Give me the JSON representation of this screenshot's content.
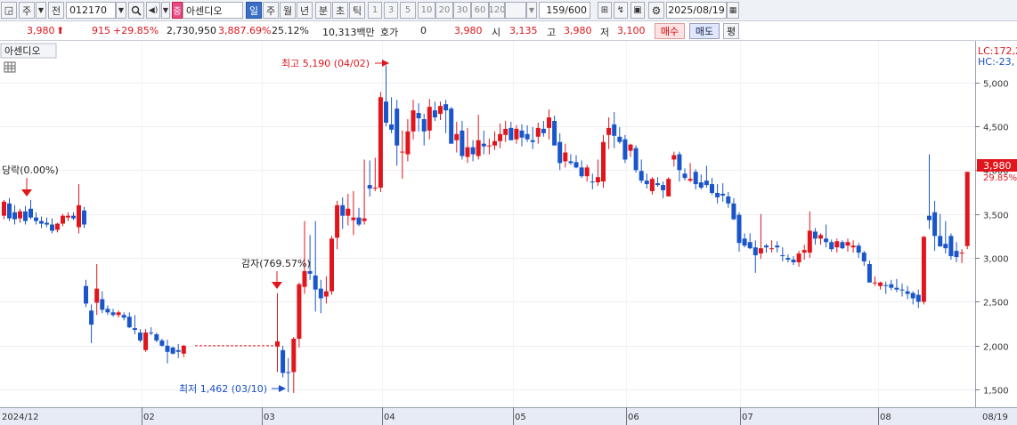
{
  "toolbar": {
    "period_type": "주",
    "prev_label": "전",
    "stock_code": "012170",
    "stock_badge": "중",
    "stock_name": "아센디오",
    "periods": [
      "일",
      "주",
      "월",
      "년",
      "분",
      "초",
      "틱"
    ],
    "selected_period": "일",
    "intervals": [
      "1",
      "3",
      "5",
      "10",
      "20",
      "30",
      "60",
      "120"
    ],
    "page_count": "159/600",
    "date": "2025/08/19"
  },
  "infobar": {
    "price": "3,980",
    "change": "915",
    "change_pct": "+29.85%",
    "volume": "2,730,950",
    "volume_pct": "3,887.69%",
    "turnover": "25.12%",
    "amount": "10,313백만",
    "quote_label": "호가",
    "quote_value": "0",
    "quote_price": "3,980",
    "open_label": "시",
    "open": "3,135",
    "high_label": "고",
    "high": "3,980",
    "low_label": "저",
    "low": "3,100",
    "buy_label": "매수",
    "sell_label": "매도",
    "avg_label": "평"
  },
  "chart_panel": {
    "title": "아센디오",
    "lc_label": "LC:172,2",
    "hc_label": "HC:-23,",
    "current_price": "3,980",
    "current_pct": "29.85%"
  },
  "chart_data": {
    "type": "candlestick",
    "yaxis_ticks": [
      1500,
      2000,
      2500,
      3000,
      3500,
      4000,
      4500,
      5000
    ],
    "ylim": [
      1300,
      5400
    ],
    "xaxis_labels": [
      "2024/12",
      "02",
      "03",
      "04",
      "05",
      "06",
      "07",
      "08",
      "08/19"
    ],
    "annotations": [
      {
        "text": "당락(0.00%)"
      },
      {
        "text": "감자(769.57%)"
      },
      {
        "text": "최고 5,190 (04/02)"
      },
      {
        "text": "최저 1,462 (03/10)"
      }
    ],
    "candles": [
      {
        "o": 3480,
        "h": 3660,
        "l": 3440,
        "c": 3640
      },
      {
        "o": 3620,
        "h": 3680,
        "l": 3420,
        "c": 3450
      },
      {
        "o": 3520,
        "h": 3600,
        "l": 3380,
        "c": 3440
      },
      {
        "o": 3450,
        "h": 3560,
        "l": 3400,
        "c": 3530
      },
      {
        "o": 3530,
        "h": 3590,
        "l": 3380,
        "c": 3420
      },
      {
        "o": 3560,
        "h": 3660,
        "l": 3440,
        "c": 3460
      },
      {
        "o": 3460,
        "h": 3520,
        "l": 3380,
        "c": 3420
      },
      {
        "o": 3420,
        "h": 3470,
        "l": 3340,
        "c": 3390
      },
      {
        "o": 3400,
        "h": 3460,
        "l": 3350,
        "c": 3380
      },
      {
        "o": 3380,
        "h": 3450,
        "l": 3280,
        "c": 3310
      },
      {
        "o": 3320,
        "h": 3400,
        "l": 3290,
        "c": 3390
      },
      {
        "o": 3390,
        "h": 3500,
        "l": 3360,
        "c": 3480
      },
      {
        "o": 3460,
        "h": 3520,
        "l": 3420,
        "c": 3480
      },
      {
        "o": 3480,
        "h": 3520,
        "l": 3430,
        "c": 3450
      },
      {
        "o": 3350,
        "h": 3840,
        "l": 3280,
        "c": 3600
      },
      {
        "o": 3540,
        "h": 3580,
        "l": 3340,
        "c": 3380
      },
      {
        "o": 2680,
        "h": 2750,
        "l": 2440,
        "c": 2480
      },
      {
        "o": 2400,
        "h": 2470,
        "l": 2030,
        "c": 2240
      },
      {
        "o": 2490,
        "h": 2930,
        "l": 2350,
        "c": 2650
      },
      {
        "o": 2530,
        "h": 2620,
        "l": 2370,
        "c": 2410
      },
      {
        "o": 2420,
        "h": 2460,
        "l": 2350,
        "c": 2380
      },
      {
        "o": 2380,
        "h": 2420,
        "l": 2330,
        "c": 2350
      },
      {
        "o": 2350,
        "h": 2400,
        "l": 2320,
        "c": 2380
      },
      {
        "o": 2350,
        "h": 2380,
        "l": 2290,
        "c": 2320
      },
      {
        "o": 2330,
        "h": 2380,
        "l": 2200,
        "c": 2210
      },
      {
        "o": 2200,
        "h": 2350,
        "l": 2130,
        "c": 2180
      },
      {
        "o": 2150,
        "h": 2190,
        "l": 2040,
        "c": 2060
      },
      {
        "o": 1950,
        "h": 2190,
        "l": 1930,
        "c": 2150
      },
      {
        "o": 2150,
        "h": 2210,
        "l": 2120,
        "c": 2140
      },
      {
        "o": 2130,
        "h": 2150,
        "l": 2040,
        "c": 2060
      },
      {
        "o": 2060,
        "h": 2080,
        "l": 1990,
        "c": 2000
      },
      {
        "o": 2000,
        "h": 2070,
        "l": 1800,
        "c": 1930
      },
      {
        "o": 1980,
        "h": 1990,
        "l": 1900,
        "c": 1910
      },
      {
        "o": 1950,
        "h": 2020,
        "l": 1860,
        "c": 1930
      },
      {
        "o": 1910,
        "h": 2010,
        "l": 1870,
        "c": 2000
      },
      {
        "o": 1990,
        "h": 2600,
        "l": 1700,
        "c": 2050
      },
      {
        "o": 1950,
        "h": 2000,
        "l": 1640,
        "c": 1690
      },
      {
        "o": 1700,
        "h": 1860,
        "l": 1470,
        "c": 1690
      },
      {
        "o": 1700,
        "h": 2100,
        "l": 1462,
        "c": 2080
      },
      {
        "o": 2080,
        "h": 2720,
        "l": 1980,
        "c": 2700
      },
      {
        "o": 2670,
        "h": 3420,
        "l": 2590,
        "c": 2850
      },
      {
        "o": 2850,
        "h": 3260,
        "l": 2750,
        "c": 2820
      },
      {
        "o": 2800,
        "h": 3420,
        "l": 2390,
        "c": 2640
      },
      {
        "o": 2650,
        "h": 2750,
        "l": 2370,
        "c": 2540
      },
      {
        "o": 2560,
        "h": 2790,
        "l": 2480,
        "c": 2620
      },
      {
        "o": 2620,
        "h": 3250,
        "l": 2580,
        "c": 3220
      },
      {
        "o": 3230,
        "h": 3650,
        "l": 3100,
        "c": 3600
      },
      {
        "o": 3600,
        "h": 3690,
        "l": 3330,
        "c": 3480
      },
      {
        "o": 3480,
        "h": 3730,
        "l": 3370,
        "c": 3560
      },
      {
        "o": 3430,
        "h": 3760,
        "l": 3260,
        "c": 3460
      },
      {
        "o": 3460,
        "h": 3570,
        "l": 3360,
        "c": 3380
      },
      {
        "o": 3420,
        "h": 4120,
        "l": 3380,
        "c": 3450
      },
      {
        "o": 3830,
        "h": 4110,
        "l": 3700,
        "c": 3790
      },
      {
        "o": 3790,
        "h": 4140,
        "l": 3760,
        "c": 3800
      },
      {
        "o": 3800,
        "h": 4890,
        "l": 3750,
        "c": 4830
      },
      {
        "o": 4780,
        "h": 5190,
        "l": 4500,
        "c": 4540
      },
      {
        "o": 4520,
        "h": 4830,
        "l": 4420,
        "c": 4460
      },
      {
        "o": 4700,
        "h": 4800,
        "l": 4050,
        "c": 4280
      },
      {
        "o": 4200,
        "h": 4450,
        "l": 3900,
        "c": 4210
      },
      {
        "o": 4180,
        "h": 4580,
        "l": 4100,
        "c": 4440
      },
      {
        "o": 4440,
        "h": 4800,
        "l": 4350,
        "c": 4680
      },
      {
        "o": 4650,
        "h": 4760,
        "l": 4440,
        "c": 4590
      },
      {
        "o": 4580,
        "h": 4640,
        "l": 4280,
        "c": 4440
      },
      {
        "o": 4450,
        "h": 4810,
        "l": 4350,
        "c": 4720
      },
      {
        "o": 4680,
        "h": 4780,
        "l": 4560,
        "c": 4600
      },
      {
        "o": 4640,
        "h": 4780,
        "l": 4570,
        "c": 4730
      },
      {
        "o": 4750,
        "h": 4800,
        "l": 4420,
        "c": 4680
      },
      {
        "o": 4700,
        "h": 4720,
        "l": 4300,
        "c": 4300
      },
      {
        "o": 4340,
        "h": 4550,
        "l": 4200,
        "c": 4410
      },
      {
        "o": 4450,
        "h": 4560,
        "l": 4120,
        "c": 4160
      },
      {
        "o": 4150,
        "h": 4480,
        "l": 4080,
        "c": 4260
      },
      {
        "o": 4260,
        "h": 4340,
        "l": 4100,
        "c": 4180
      },
      {
        "o": 4160,
        "h": 4630,
        "l": 4120,
        "c": 4340
      },
      {
        "o": 4300,
        "h": 4450,
        "l": 4180,
        "c": 4270
      },
      {
        "o": 4270,
        "h": 4360,
        "l": 4180,
        "c": 4280
      },
      {
        "o": 4280,
        "h": 4440,
        "l": 4230,
        "c": 4330
      },
      {
        "o": 4330,
        "h": 4530,
        "l": 4250,
        "c": 4410
      },
      {
        "o": 4400,
        "h": 4560,
        "l": 4320,
        "c": 4470
      },
      {
        "o": 4480,
        "h": 4550,
        "l": 4340,
        "c": 4340
      },
      {
        "o": 4350,
        "h": 4510,
        "l": 4300,
        "c": 4470
      },
      {
        "o": 4450,
        "h": 4520,
        "l": 4270,
        "c": 4370
      },
      {
        "o": 4410,
        "h": 4510,
        "l": 4320,
        "c": 4350
      },
      {
        "o": 4340,
        "h": 4490,
        "l": 4240,
        "c": 4320
      },
      {
        "o": 4380,
        "h": 4540,
        "l": 4300,
        "c": 4480
      },
      {
        "o": 4470,
        "h": 4560,
        "l": 4380,
        "c": 4420
      },
      {
        "o": 4480,
        "h": 4690,
        "l": 4350,
        "c": 4600
      },
      {
        "o": 4560,
        "h": 4620,
        "l": 4280,
        "c": 4280
      },
      {
        "o": 4320,
        "h": 4420,
        "l": 4000,
        "c": 4080
      },
      {
        "o": 4100,
        "h": 4300,
        "l": 4030,
        "c": 4200
      },
      {
        "o": 4100,
        "h": 4180,
        "l": 4060,
        "c": 4080
      },
      {
        "o": 4090,
        "h": 4170,
        "l": 4020,
        "c": 4030
      },
      {
        "o": 4030,
        "h": 4110,
        "l": 3910,
        "c": 3930
      },
      {
        "o": 3930,
        "h": 4060,
        "l": 3870,
        "c": 4030
      },
      {
        "o": 3870,
        "h": 3960,
        "l": 3780,
        "c": 3860
      },
      {
        "o": 3860,
        "h": 4120,
        "l": 3820,
        "c": 3920
      },
      {
        "o": 3870,
        "h": 4400,
        "l": 3800,
        "c": 4320
      },
      {
        "o": 4400,
        "h": 4600,
        "l": 4240,
        "c": 4480
      },
      {
        "o": 4520,
        "h": 4660,
        "l": 4250,
        "c": 4390
      },
      {
        "o": 4380,
        "h": 4490,
        "l": 4300,
        "c": 4320
      },
      {
        "o": 4350,
        "h": 4400,
        "l": 4080,
        "c": 4120
      },
      {
        "o": 4220,
        "h": 4300,
        "l": 4150,
        "c": 4290
      },
      {
        "o": 4250,
        "h": 4280,
        "l": 3970,
        "c": 4000
      },
      {
        "o": 3990,
        "h": 4120,
        "l": 3850,
        "c": 3880
      },
      {
        "o": 3880,
        "h": 3960,
        "l": 3790,
        "c": 3840
      },
      {
        "o": 3760,
        "h": 3920,
        "l": 3720,
        "c": 3900
      },
      {
        "o": 3850,
        "h": 3920,
        "l": 3810,
        "c": 3830
      },
      {
        "o": 3830,
        "h": 3870,
        "l": 3680,
        "c": 3770
      },
      {
        "o": 3700,
        "h": 3920,
        "l": 3730,
        "c": 3900
      },
      {
        "o": 4120,
        "h": 4210,
        "l": 4040,
        "c": 4170
      },
      {
        "o": 4180,
        "h": 4210,
        "l": 3870,
        "c": 4000
      },
      {
        "o": 3960,
        "h": 4020,
        "l": 3880,
        "c": 3910
      },
      {
        "o": 3880,
        "h": 4080,
        "l": 3860,
        "c": 3900
      },
      {
        "o": 3980,
        "h": 4010,
        "l": 3780,
        "c": 3840
      },
      {
        "o": 3860,
        "h": 3950,
        "l": 3780,
        "c": 3800
      },
      {
        "o": 3880,
        "h": 4050,
        "l": 3800,
        "c": 3830
      },
      {
        "o": 3840,
        "h": 3910,
        "l": 3720,
        "c": 3740
      },
      {
        "o": 3740,
        "h": 3840,
        "l": 3620,
        "c": 3690
      },
      {
        "o": 3730,
        "h": 3850,
        "l": 3640,
        "c": 3710
      },
      {
        "o": 3700,
        "h": 3750,
        "l": 3570,
        "c": 3620
      },
      {
        "o": 3620,
        "h": 3680,
        "l": 3430,
        "c": 3440
      },
      {
        "o": 3490,
        "h": 3520,
        "l": 3070,
        "c": 3170
      },
      {
        "o": 3220,
        "h": 3280,
        "l": 3120,
        "c": 3140
      },
      {
        "o": 3180,
        "h": 3280,
        "l": 3100,
        "c": 3110
      },
      {
        "o": 3120,
        "h": 3200,
        "l": 2830,
        "c": 3030
      },
      {
        "o": 3050,
        "h": 3500,
        "l": 2990,
        "c": 3110
      },
      {
        "o": 3140,
        "h": 3160,
        "l": 3060,
        "c": 3120
      },
      {
        "o": 3110,
        "h": 3200,
        "l": 3060,
        "c": 3110
      },
      {
        "o": 3140,
        "h": 3190,
        "l": 3060,
        "c": 3120
      },
      {
        "o": 3030,
        "h": 3120,
        "l": 2960,
        "c": 3020
      },
      {
        "o": 3000,
        "h": 3040,
        "l": 2950,
        "c": 2980
      },
      {
        "o": 2980,
        "h": 3020,
        "l": 2920,
        "c": 2950
      },
      {
        "o": 2950,
        "h": 3080,
        "l": 2900,
        "c": 3050
      },
      {
        "o": 3060,
        "h": 3150,
        "l": 2980,
        "c": 3090
      },
      {
        "o": 3060,
        "h": 3530,
        "l": 3000,
        "c": 3310
      },
      {
        "o": 3300,
        "h": 3340,
        "l": 3150,
        "c": 3220
      },
      {
        "o": 3220,
        "h": 3280,
        "l": 3150,
        "c": 3260
      },
      {
        "o": 3220,
        "h": 3380,
        "l": 3120,
        "c": 3180
      },
      {
        "o": 3180,
        "h": 3210,
        "l": 3070,
        "c": 3100
      },
      {
        "o": 3120,
        "h": 3220,
        "l": 3060,
        "c": 3190
      },
      {
        "o": 3180,
        "h": 3200,
        "l": 3100,
        "c": 3110
      },
      {
        "o": 3140,
        "h": 3220,
        "l": 3070,
        "c": 3180
      },
      {
        "o": 3120,
        "h": 3200,
        "l": 3060,
        "c": 3140
      },
      {
        "o": 3140,
        "h": 3170,
        "l": 3000,
        "c": 3060
      },
      {
        "o": 3060,
        "h": 3080,
        "l": 2910,
        "c": 2960
      },
      {
        "o": 2930,
        "h": 2970,
        "l": 2720,
        "c": 2720
      },
      {
        "o": 2720,
        "h": 2790,
        "l": 2680,
        "c": 2720
      },
      {
        "o": 2680,
        "h": 2730,
        "l": 2640,
        "c": 2720
      },
      {
        "o": 2690,
        "h": 2730,
        "l": 2590,
        "c": 2680
      },
      {
        "o": 2700,
        "h": 2750,
        "l": 2630,
        "c": 2660
      },
      {
        "o": 2660,
        "h": 2760,
        "l": 2610,
        "c": 2640
      },
      {
        "o": 2640,
        "h": 2710,
        "l": 2560,
        "c": 2630
      },
      {
        "o": 2620,
        "h": 2680,
        "l": 2530,
        "c": 2590
      },
      {
        "o": 2600,
        "h": 2620,
        "l": 2470,
        "c": 2540
      },
      {
        "o": 2580,
        "h": 2640,
        "l": 2430,
        "c": 2500
      },
      {
        "o": 2500,
        "h": 3250,
        "l": 2470,
        "c": 3240
      },
      {
        "o": 3480,
        "h": 4180,
        "l": 3330,
        "c": 3430
      },
      {
        "o": 3520,
        "h": 3650,
        "l": 3080,
        "c": 3250
      },
      {
        "o": 3250,
        "h": 3500,
        "l": 3130,
        "c": 3130
      },
      {
        "o": 3160,
        "h": 3420,
        "l": 3050,
        "c": 3110
      },
      {
        "o": 3250,
        "h": 3280,
        "l": 2980,
        "c": 3020
      },
      {
        "o": 3080,
        "h": 3180,
        "l": 2950,
        "c": 3010
      },
      {
        "o": 3050,
        "h": 3100,
        "l": 2940,
        "c": 3060
      },
      {
        "o": 3135,
        "h": 3980,
        "l": 3100,
        "c": 3980
      }
    ],
    "reference_lines": [
      {
        "value": 2000
      }
    ]
  }
}
